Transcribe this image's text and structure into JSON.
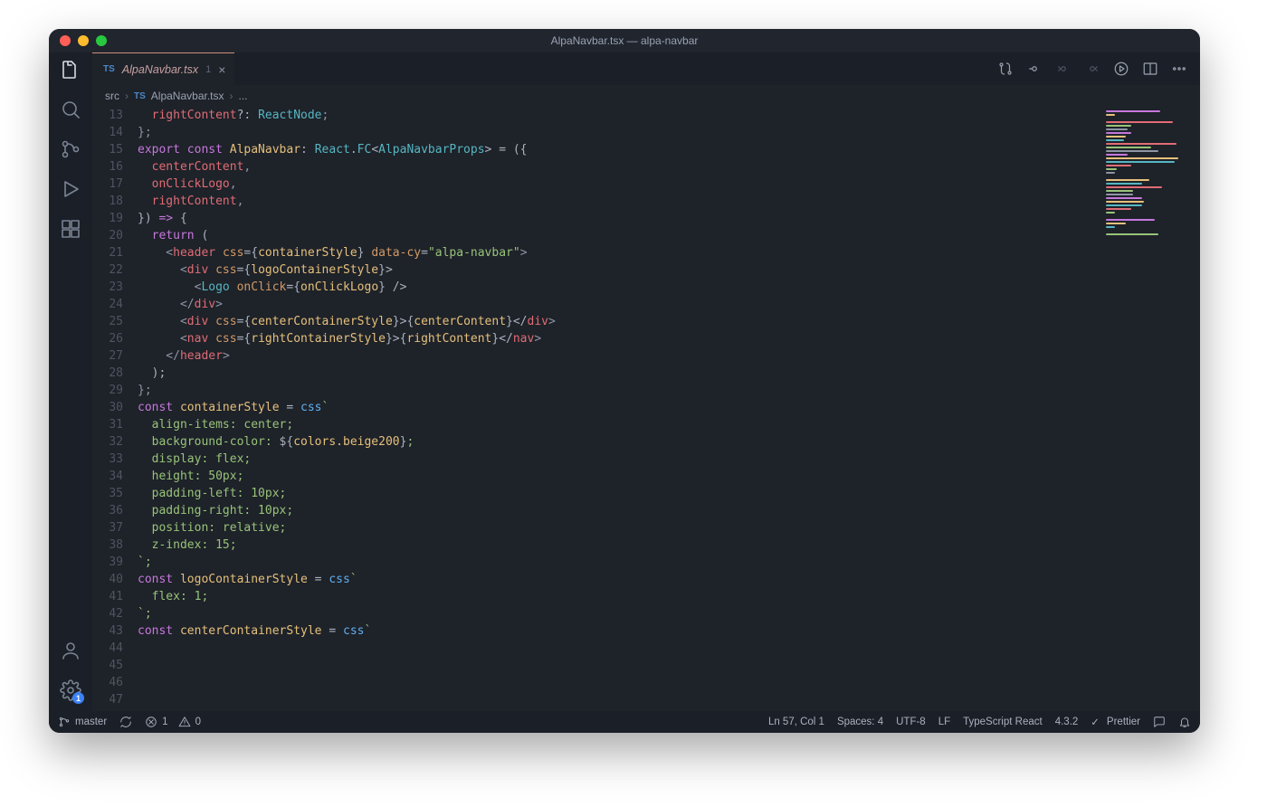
{
  "titlebar": {
    "title": "AlpaNavbar.tsx — alpa-navbar"
  },
  "activity": {
    "settings_badge": "1"
  },
  "tab": {
    "lang_badge": "TS",
    "filename": "AlpaNavbar.tsx",
    "problem_count": "1"
  },
  "breadcrumbs": [
    "src",
    "AlpaNavbar.tsx",
    "..."
  ],
  "status": {
    "branch": "master",
    "errors": "1",
    "warnings": "0",
    "cursor": "Ln 57, Col 1",
    "spaces": "Spaces: 4",
    "encoding": "UTF-8",
    "eol": "LF",
    "language": "TypeScript React",
    "ts_version": "4.3.2",
    "prettier": "Prettier"
  },
  "code": {
    "first_line_number": 13,
    "lines": [
      [
        [
          "  ",
          ""
        ],
        [
          "rightContent",
          "pr"
        ],
        [
          "?: ",
          "op"
        ],
        [
          "ReactNode",
          "ty"
        ],
        [
          ";",
          "pu"
        ]
      ],
      [
        [
          "};",
          "pu"
        ]
      ],
      [
        [
          "",
          ""
        ]
      ],
      [
        [
          "export const ",
          "kw"
        ],
        [
          "AlpaNavbar",
          "id"
        ],
        [
          ": ",
          "op"
        ],
        [
          "React",
          "ty"
        ],
        [
          ".",
          "op"
        ],
        [
          "FC",
          "ty"
        ],
        [
          "<",
          "op"
        ],
        [
          "AlpaNavbarProps",
          "ty"
        ],
        [
          "> = ({",
          "op"
        ]
      ],
      [
        [
          "  ",
          ""
        ],
        [
          "centerContent",
          "pr"
        ],
        [
          ",",
          "pu"
        ]
      ],
      [
        [
          "  ",
          ""
        ],
        [
          "onClickLogo",
          "pr"
        ],
        [
          ",",
          "pu"
        ]
      ],
      [
        [
          "  ",
          ""
        ],
        [
          "rightContent",
          "pr"
        ],
        [
          ",",
          "pu"
        ]
      ],
      [
        [
          "}) ",
          "op"
        ],
        [
          "=>",
          "kw"
        ],
        [
          " {",
          "op"
        ]
      ],
      [
        [
          "  ",
          ""
        ],
        [
          "return ",
          "kw"
        ],
        [
          "(",
          "op"
        ]
      ],
      [
        [
          "    <",
          "pu"
        ],
        [
          "header",
          "tg"
        ],
        [
          " ",
          ""
        ],
        [
          "css",
          "at"
        ],
        [
          "={",
          "op"
        ],
        [
          "containerStyle",
          "id"
        ],
        [
          "} ",
          "op"
        ],
        [
          "data-cy",
          "at"
        ],
        [
          "=",
          "op"
        ],
        [
          "\"alpa-navbar\"",
          "st"
        ],
        [
          ">",
          "pu"
        ]
      ],
      [
        [
          "      <",
          "pu"
        ],
        [
          "div",
          "tg"
        ],
        [
          " ",
          ""
        ],
        [
          "css",
          "at"
        ],
        [
          "={",
          "op"
        ],
        [
          "logoContainerStyle",
          "id"
        ],
        [
          "}>",
          "op"
        ]
      ],
      [
        [
          "        <",
          "pu"
        ],
        [
          "Logo",
          "ty"
        ],
        [
          " ",
          ""
        ],
        [
          "onClick",
          "at"
        ],
        [
          "={",
          "op"
        ],
        [
          "onClickLogo",
          "id"
        ],
        [
          "} />",
          "op"
        ]
      ],
      [
        [
          "      </",
          "pu"
        ],
        [
          "div",
          "tg"
        ],
        [
          ">",
          "pu"
        ]
      ],
      [
        [
          "      <",
          "pu"
        ],
        [
          "div",
          "tg"
        ],
        [
          " ",
          ""
        ],
        [
          "css",
          "at"
        ],
        [
          "={",
          "op"
        ],
        [
          "centerContainerStyle",
          "id"
        ],
        [
          "}>{",
          "op"
        ],
        [
          "centerContent",
          "id"
        ],
        [
          "}</",
          "op"
        ],
        [
          "div",
          "tg"
        ],
        [
          ">",
          "pu"
        ]
      ],
      [
        [
          "      <",
          "pu"
        ],
        [
          "nav",
          "tg"
        ],
        [
          " ",
          ""
        ],
        [
          "css",
          "at"
        ],
        [
          "={",
          "op"
        ],
        [
          "rightContainerStyle",
          "id"
        ],
        [
          "}>{",
          "op"
        ],
        [
          "rightContent",
          "id"
        ],
        [
          "}</",
          "op"
        ],
        [
          "nav",
          "tg"
        ],
        [
          ">",
          "pu"
        ]
      ],
      [
        [
          "    </",
          "pu"
        ],
        [
          "header",
          "tg"
        ],
        [
          ">",
          "pu"
        ]
      ],
      [
        [
          "  );",
          "op"
        ]
      ],
      [
        [
          "};",
          "pu"
        ]
      ],
      [
        [
          "",
          ""
        ]
      ],
      [
        [
          "const ",
          "kw"
        ],
        [
          "containerStyle",
          "id"
        ],
        [
          " = ",
          "op"
        ],
        [
          "css",
          "fn"
        ],
        [
          "`",
          "st"
        ]
      ],
      [
        [
          "  align-items: center;",
          "st"
        ]
      ],
      [
        [
          "  background-color: ",
          "st"
        ],
        [
          "${",
          "op"
        ],
        [
          "colors.beige200",
          "id"
        ],
        [
          "}",
          "op"
        ],
        [
          ";",
          "st"
        ]
      ],
      [
        [
          "  display: flex;",
          "st"
        ]
      ],
      [
        [
          "  height: 50px;",
          "st"
        ]
      ],
      [
        [
          "  padding-left: 10px;",
          "st"
        ]
      ],
      [
        [
          "  padding-right: 10px;",
          "st"
        ]
      ],
      [
        [
          "  position: relative;",
          "st"
        ]
      ],
      [
        [
          "  z-index: 15;",
          "st"
        ]
      ],
      [
        [
          "`;",
          "st"
        ]
      ],
      [
        [
          "",
          ""
        ]
      ],
      [
        [
          "const ",
          "kw"
        ],
        [
          "logoContainerStyle",
          "id"
        ],
        [
          " = ",
          "op"
        ],
        [
          "css",
          "fn"
        ],
        [
          "`",
          "st"
        ]
      ],
      [
        [
          "  flex: 1;",
          "st"
        ]
      ],
      [
        [
          "`;",
          "st"
        ]
      ],
      [
        [
          "",
          ""
        ]
      ],
      [
        [
          "const ",
          "kw"
        ],
        [
          "centerContainerStyle",
          "id"
        ],
        [
          " = ",
          "op"
        ],
        [
          "css",
          "fn"
        ],
        [
          "`",
          "st"
        ]
      ]
    ]
  },
  "minimap_widths": [
    60,
    10,
    0,
    74,
    28,
    24,
    28,
    22,
    20,
    78,
    50,
    58,
    24,
    80,
    76,
    28,
    12,
    10,
    0,
    48,
    40,
    62,
    30,
    30,
    40,
    42,
    40,
    28,
    10,
    0,
    54,
    22,
    10,
    0,
    58
  ]
}
